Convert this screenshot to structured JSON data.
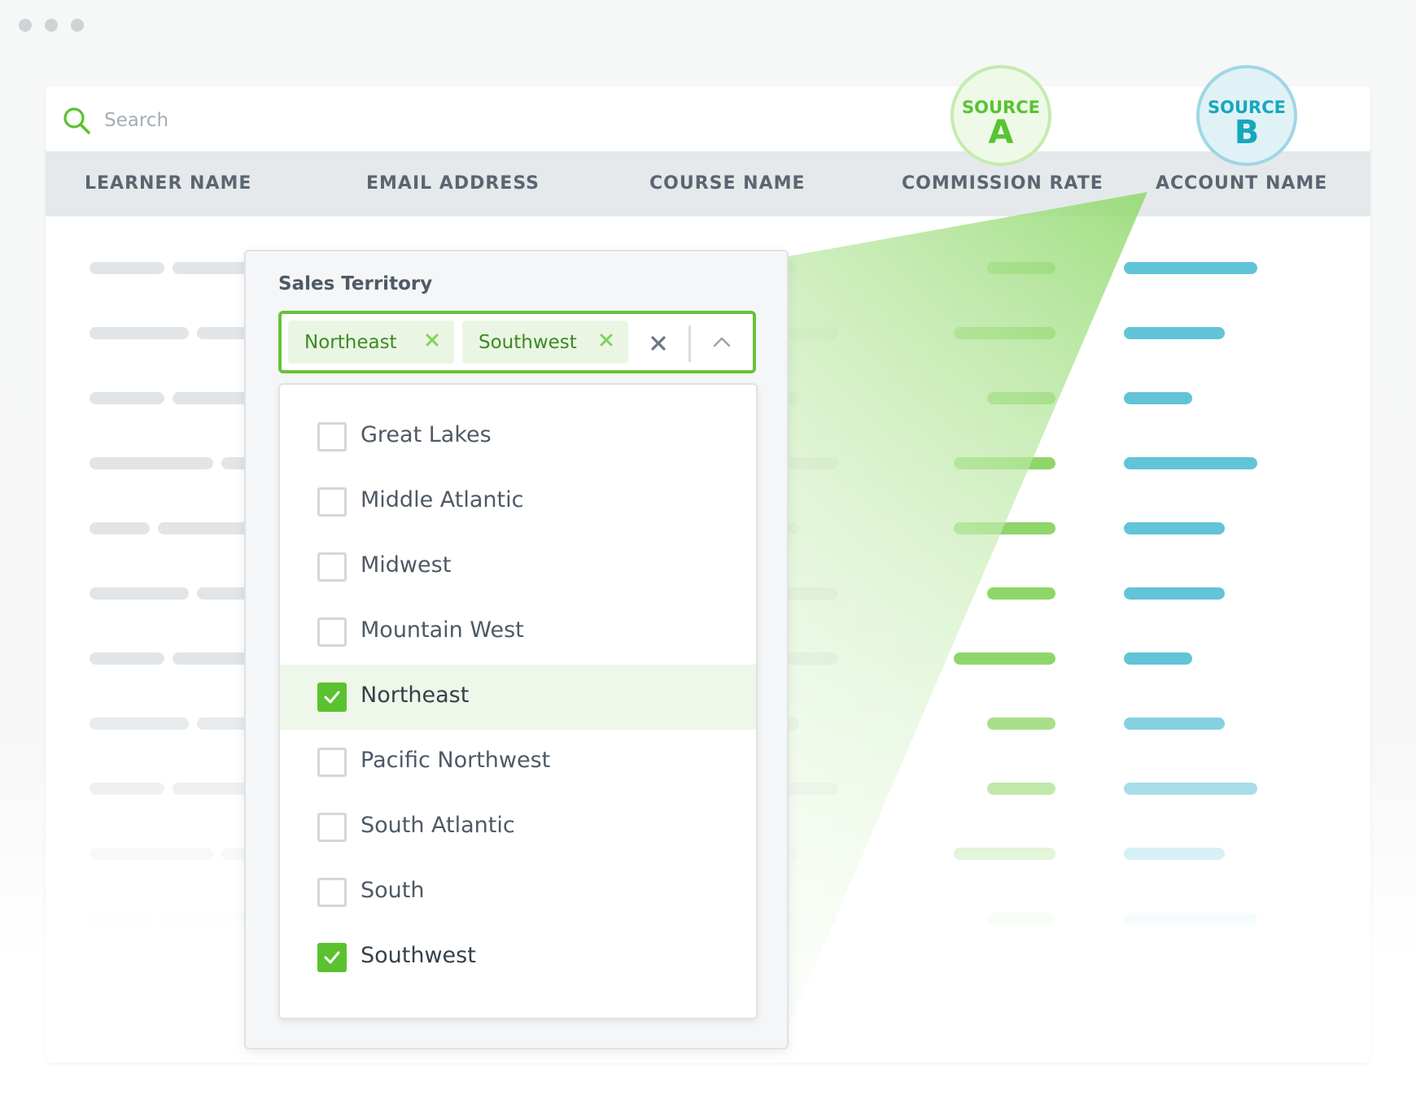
{
  "window": {
    "traffic_dots": 3
  },
  "search": {
    "placeholder": "Search",
    "icon": "search-icon"
  },
  "table": {
    "columns": [
      "LEARNER NAME",
      "EMAIL ADDRESS",
      "COURSE NAME",
      "COMMISSION RATE",
      "ACCOUNT NAME"
    ]
  },
  "badges": {
    "a": {
      "source": "SOURCE",
      "letter": "A",
      "color": "#58c234"
    },
    "b": {
      "source": "SOURCE",
      "letter": "B",
      "color": "#17a7bd"
    }
  },
  "filter": {
    "label": "Sales Territory",
    "chips": [
      "Northeast",
      "Southwest"
    ],
    "options": [
      {
        "label": "Great Lakes",
        "checked": false
      },
      {
        "label": "Middle Atlantic",
        "checked": false
      },
      {
        "label": "Midwest",
        "checked": false
      },
      {
        "label": "Mountain West",
        "checked": false
      },
      {
        "label": "Northeast",
        "checked": true,
        "highlighted": true
      },
      {
        "label": "Pacific Northwest",
        "checked": false
      },
      {
        "label": "South Atlantic",
        "checked": false
      },
      {
        "label": "South",
        "checked": false
      },
      {
        "label": "Southwest",
        "checked": true
      }
    ]
  },
  "colors": {
    "accent_green": "#5ac22f",
    "accent_teal": "#5fc3d6",
    "placeholder_gray": "#e2e5e8"
  }
}
